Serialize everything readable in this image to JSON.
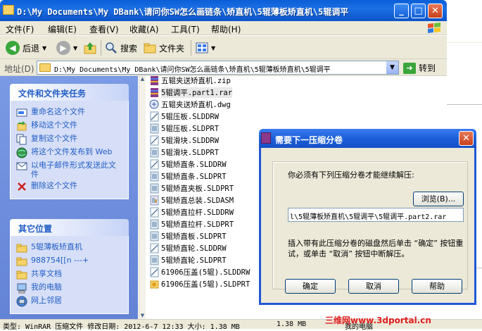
{
  "window": {
    "title": "D:\\My Documents\\My DBank\\请问你SW怎么画链条\\矫直机\\5辊薄板矫直机\\5辊调平",
    "menu": [
      "文件(F)",
      "编辑(E)",
      "查看(V)",
      "收藏(A)",
      "工具(T)",
      "帮助(H)"
    ],
    "toolbar": {
      "back": "后退",
      "search": "搜索",
      "folders": "文件夹"
    },
    "address": {
      "label": "地址(D)",
      "value": "D:\\My Documents\\My DBank\\请问你SW怎么画链条\\矫直机\\5辊薄板矫直机\\5辊调平",
      "go": "转到"
    }
  },
  "sidebar": {
    "tasks": {
      "title": "文件和文件夹任务",
      "items": [
        {
          "label": "重命名这个文件",
          "icon": "rename-icon"
        },
        {
          "label": "移动这个文件",
          "icon": "move-icon"
        },
        {
          "label": "复制这个文件",
          "icon": "copy-icon"
        },
        {
          "label": "将这个文件发布到 Web",
          "icon": "globe-icon"
        },
        {
          "label": "以电子邮件形式发送此文件",
          "icon": "email-icon"
        },
        {
          "label": "删除这个文件",
          "icon": "delete-icon"
        }
      ]
    },
    "places": {
      "title": "其它位置",
      "items": [
        {
          "label": "5辊薄板矫直机",
          "icon": "folder-icon"
        },
        {
          "label": "988754[[n ---+",
          "icon": "folder-icon"
        },
        {
          "label": "共享文档",
          "icon": "folder-icon"
        },
        {
          "label": "我的电脑",
          "icon": "computer-icon"
        },
        {
          "label": "网上邻居",
          "icon": "network-icon"
        }
      ]
    }
  },
  "files": [
    {
      "name": "五辊夹送矫直机.zip",
      "type": "winrar"
    },
    {
      "name": "5辊调平.part1.rar",
      "type": "winrar",
      "selected": true
    },
    {
      "name": "五辊夹送矫直机.dwg",
      "type": "dwg"
    },
    {
      "name": "5辊压板.SLDDRW",
      "type": "slddrw"
    },
    {
      "name": "5辊压板.SLDPRT",
      "type": "sldprt"
    },
    {
      "name": "5辊滑块.SLDDRW",
      "type": "slddrw"
    },
    {
      "name": "5辊滑块.SLDPRT",
      "type": "sldprt"
    },
    {
      "name": "5辊矫直条.SLDDRW",
      "type": "slddrw"
    },
    {
      "name": "5辊矫直条.SLDPRT",
      "type": "sldprt"
    },
    {
      "name": "5辊矫直夹板.SLDPRT",
      "type": "sldprt"
    },
    {
      "name": "5辊矫直总装.SLDASM",
      "type": "sldasm"
    },
    {
      "name": "5辊矫直拉杆.SLDDRW",
      "type": "slddrw"
    },
    {
      "name": "5辊矫直拉杆.SLDPRT",
      "type": "sldprt"
    },
    {
      "name": "5辊矫直板.SLDPRT",
      "type": "sldprt"
    },
    {
      "name": "5辊矫直轮.SLDDRW",
      "type": "slddrw"
    },
    {
      "name": "5辊矫直轮.SLDPRT",
      "type": "sldprt"
    },
    {
      "name": "61906压盖(5辊).SLDDRW",
      "type": "slddrw"
    },
    {
      "name": "61906压盖(5辊).SLDPRT",
      "type": "sldprt-yellow"
    }
  ],
  "status": {
    "type": "类型: WinRAR 压缩文件 修改日期: 2012-6-7 12:33 大小: 1.38 MB",
    "size": "1.38 MB",
    "location": "我的电脑"
  },
  "watermark": "三维网www.3dportal.cn",
  "dialog": {
    "title": "需要下一压缩分卷",
    "message": "你必须有下列压缩分卷才能继续解压:",
    "browse": "浏览(B)...",
    "path": "l\\5辊薄板矫直机\\5辊调平\\5辊调平.part2.rar",
    "hint": "插入带有此压缩分卷的磁盘然后单击 “确定” 按钮重试，或单击 “取消” 按钮中断解压。",
    "ok": "确定",
    "cancel": "取消",
    "help": "帮助"
  },
  "colors": {
    "titlebar": "#0a5fd8",
    "sidebar": "#7a9ae5",
    "task_link": "#215dc6",
    "watermark": "#e02020"
  }
}
